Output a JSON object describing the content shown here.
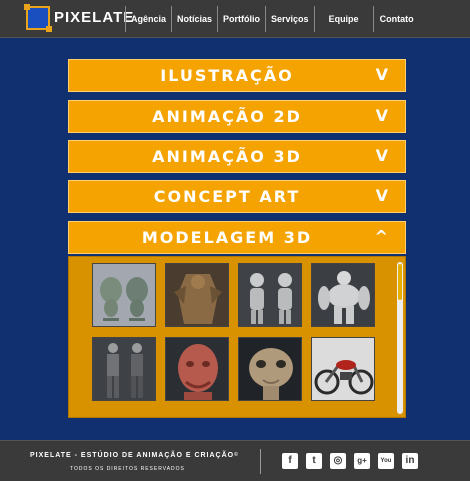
{
  "header": {
    "logo_text": "PIXELATE",
    "nav": [
      "Agência",
      "Notícias",
      "Portfólio",
      "Serviços",
      "Equipe",
      "Contato"
    ]
  },
  "accordion": [
    {
      "title": "ILUSTRAÇÃO",
      "chevron": "V"
    },
    {
      "title": "ANIMAÇÃO 2D",
      "chevron": "V"
    },
    {
      "title": "ANIMAÇÃO 3D",
      "chevron": "V"
    },
    {
      "title": "CONCEPT ART",
      "chevron": "V"
    },
    {
      "title": "MODELAGEM 3D",
      "chevron": "^"
    }
  ],
  "gallery": [
    "cartoon-bird-model-thumbnail",
    "armored-warrior-model-thumbnail",
    "goblin-model-thumbnail",
    "muscular-creature-model-thumbnail",
    "human-figures-model-thumbnail",
    "red-creature-bust-thumbnail",
    "alien-head-model-thumbnail",
    "motorcycle-model-thumbnail"
  ],
  "footer": {
    "line1": "PIXELATE - ESTÚDIO DE ANIMAÇÃO E CRIAÇÃO",
    "copyright": "©",
    "line2": "TODOS OS DIREITOS RESERVADOS",
    "social": [
      {
        "icon": "facebook-icon",
        "glyph": "f"
      },
      {
        "icon": "twitter-icon",
        "glyph": "t"
      },
      {
        "icon": "instagram-icon",
        "glyph": "◎"
      },
      {
        "icon": "google-plus-icon",
        "glyph": "g+"
      },
      {
        "icon": "youtube-icon",
        "glyph": "You"
      },
      {
        "icon": "linkedin-icon",
        "glyph": "in"
      }
    ]
  },
  "colors": {
    "page_bg": "#103070",
    "accent": "#f5a300",
    "panel": "#d89200",
    "bar": "#3a3a3a"
  }
}
